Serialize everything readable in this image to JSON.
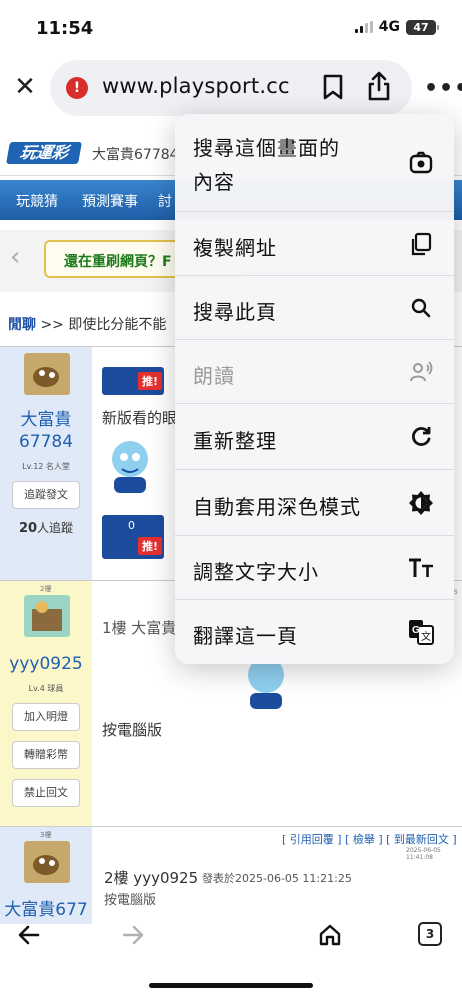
{
  "status_bar": {
    "time": "11:54",
    "network": "4G",
    "battery": "47"
  },
  "browser": {
    "url": "www.playsport.cc",
    "tab_count": "3"
  },
  "page": {
    "logo_text": "玩運彩",
    "header_user": "大富貴67784",
    "nav_items": [
      "玩競猜",
      "預測賽事",
      "討"
    ],
    "banner_text": "還在重刷網頁？F",
    "breadcrumb_link": "閒聊",
    "breadcrumb_text": ">> 即使比分能不能",
    "posts": [
      {
        "username": "大富貴67784",
        "level": "Lv.12 名人堂",
        "follow_button": "追蹤發文",
        "followers_count": "20",
        "followers_suffix": "人追蹤",
        "push_label": "推!",
        "push_count": "0",
        "text": "新版看的眼"
      },
      {
        "floor": "2樓",
        "username": "yyy0925",
        "level": "Lv.4 球員",
        "buttons": [
          "加入明燈",
          "轉贈彩幣",
          "禁止回文"
        ],
        "quote": "1樓 大富貴",
        "body": "按電腦版",
        "date_fragment": "25"
      },
      {
        "floor": "3樓",
        "username": "大富貴677",
        "links": "[ 引用回覆 ]  [ 檢舉 ]  [ 到最新回文 ]",
        "timestamp": "2025-06-05 11:41:08",
        "reply_user": "2樓 yyy0925",
        "reply_meta": "發表於2025-06-05 11:21:25",
        "reply_text": "按電腦版"
      }
    ]
  },
  "context_menu": {
    "items": [
      {
        "label_line1": "搜尋這個畫面的",
        "label_line2": "內容",
        "icon": "google-lens-icon",
        "disabled": false
      },
      {
        "label": "複製網址",
        "icon": "copy-icon",
        "disabled": false
      },
      {
        "label": "搜尋此頁",
        "icon": "search-icon",
        "disabled": false
      },
      {
        "label": "朗讀",
        "icon": "read-aloud-icon",
        "disabled": true
      },
      {
        "label": "重新整理",
        "icon": "refresh-icon",
        "disabled": false
      },
      {
        "label": "自動套用深色模式",
        "icon": "dark-mode-icon",
        "disabled": false
      },
      {
        "label": "調整文字大小",
        "icon": "text-size-icon",
        "disabled": false
      },
      {
        "label": "翻譯這一頁",
        "icon": "translate-icon",
        "disabled": false
      }
    ]
  },
  "colors": {
    "accent_blue": "#1f5fb0",
    "nav_blue": "#2b74c0",
    "warn_red": "#d62d2d",
    "menu_bg": "#f6f6f8"
  }
}
